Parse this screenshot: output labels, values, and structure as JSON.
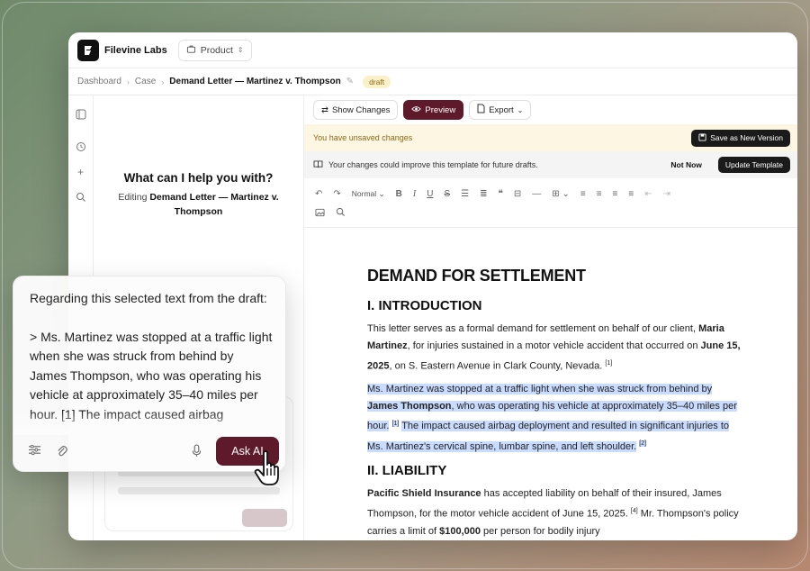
{
  "topbar": {
    "brand": "Filevine Labs",
    "product_label": "Product"
  },
  "breadcrumb": {
    "items": [
      "Dashboard",
      "Case"
    ],
    "current": "Demand Letter — Martinez v. Thompson",
    "badge": "draft"
  },
  "chat": {
    "title": "What can I help you with?",
    "editing_prefix": "Editing",
    "editing_doc": "Demand Letter — Martinez v. Thompson"
  },
  "toolbar": {
    "show_changes": "Show Changes",
    "preview": "Preview",
    "export": "Export"
  },
  "unsaved": {
    "text": "You have unsaved changes",
    "save_button": "Save as New Version"
  },
  "improve": {
    "text": "Your changes could improve this template for future drafts.",
    "not_now": "Not Now",
    "update": "Update Template"
  },
  "format": {
    "style": "Normal"
  },
  "document": {
    "title": "DEMAND FOR SETTLEMENT",
    "section1": "I. INTRODUCTION",
    "p1_a": "This letter serves as a formal demand for settlement on behalf of our client,",
    "p1_client": "Maria Martinez",
    "p1_b": ", for injuries sustained in a motor vehicle accident that occurred on",
    "p1_date": "June 15, 2025",
    "p1_c": ", on S. Eastern Avenue in Clark County, Nevada.",
    "p1_ref": "[1]",
    "p2_a": "Ms. Martinez was stopped at a traffic light when she was struck from behind by",
    "p2_name": "James Thompson",
    "p2_b": ", who was operating his vehicle at approximately 35–40 miles per hour.",
    "p2_ref1": "[1]",
    "p2_c": "The impact caused airbag deployment and resulted in significant injuries to Ms. Martinez's cervical spine, lumbar spine, and left shoulder.",
    "p2_ref2": "[2]",
    "section2": "II. LIABILITY",
    "p3_insurer": "Pacific Shield Insurance",
    "p3_a": " has accepted liability on behalf of their insured, James Thompson, for the motor vehicle accident of June 15, 2025.",
    "p3_ref": "[4]",
    "p3_b": "Mr. Thompson's policy carries a limit of",
    "p3_amount": "$100,000",
    "p3_c": " per person for bodily injury"
  },
  "prompt": {
    "line1": "Regarding this selected text from the draft:",
    "quote": "> Ms. Martinez was stopped at a traffic light when she was struck from behind by James Thompson, who was operating his vehicle at approximately 35–40 miles per hour. [1] The impact caused airbag",
    "ask_label": "Ask AI"
  }
}
